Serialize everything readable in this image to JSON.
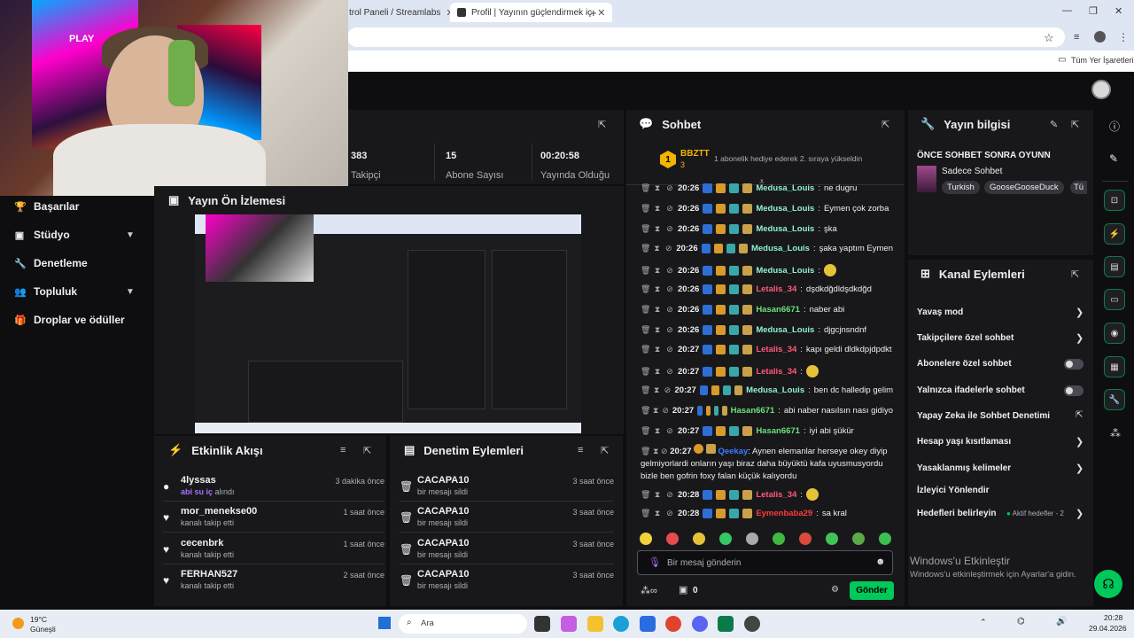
{
  "browser": {
    "tab1": "trol Paneli / Streamlabs",
    "tab2": "Profil | Yayının güçlendirmek iç",
    "bookmarks": "Tüm Yer İşaretleri",
    "new_tab": "+"
  },
  "webcam": {
    "play_text": "PLAY"
  },
  "nav": [
    {
      "label": "Başarılar",
      "icon": "trophy-icon"
    },
    {
      "label": "Stüdyo",
      "icon": "studio-icon"
    },
    {
      "label": "Denetleme",
      "icon": "wrench-icon"
    },
    {
      "label": "Topluluk",
      "icon": "community-icon"
    },
    {
      "label": "Droplar ve ödüller",
      "icon": "gift-icon"
    }
  ],
  "stats": [
    {
      "value": "383",
      "label": "Takipçi"
    },
    {
      "value": "15",
      "label": "Abone Sayısı"
    },
    {
      "value": "00:20:58",
      "label": "Yayında Olduğu"
    }
  ],
  "preview": {
    "title": "Yayın Ön İzlemesi"
  },
  "activity": {
    "title": "Etkinlik Akışı",
    "items": [
      {
        "name": "4lyssas",
        "sub_hl": "abi su iç",
        "sub": "alındı",
        "time": "3 dakika önce",
        "icon": "bits-icon"
      },
      {
        "name": "mor_menekse00",
        "sub": "kanalı takip etti",
        "time": "1 saat önce",
        "icon": "heart-icon"
      },
      {
        "name": "cecenbrk",
        "sub": "kanalı takip etti",
        "time": "1 saat önce",
        "icon": "heart-icon"
      },
      {
        "name": "FERHAN527",
        "sub": "kanalı takip etti",
        "time": "2 saat önce",
        "icon": "heart-icon"
      }
    ]
  },
  "moderation": {
    "title": "Denetim Eylemleri",
    "items": [
      {
        "name": "CACAPA10",
        "sub": "bir mesajı sildi",
        "time": "3 saat önce"
      },
      {
        "name": "CACAPA10",
        "sub": "bir mesajı sildi",
        "time": "3 saat önce"
      },
      {
        "name": "CACAPA10",
        "sub": "bir mesajı sildi",
        "time": "3 saat önce"
      },
      {
        "name": "CACAPA10",
        "sub": "bir mesajı sildi",
        "time": "3 saat önce"
      }
    ]
  },
  "chat": {
    "title": "Sohbet",
    "top_gifter": "BBZTT",
    "top_gifter_count": "3",
    "top_gifter_rank": "1",
    "gift_note": "1 abonelik hediye ederek 2. sıraya yükseldin",
    "messages": [
      {
        "time": "20:26",
        "user": "Medusa_Louis",
        "color": "#8ff0d0",
        "text": "ne dugru"
      },
      {
        "time": "20:26",
        "user": "Medusa_Louis",
        "color": "#8ff0d0",
        "text": "Eymen çok zorba"
      },
      {
        "time": "20:26",
        "user": "Medusa_Louis",
        "color": "#8ff0d0",
        "text": "şka"
      },
      {
        "time": "20:26",
        "user": "Medusa_Louis",
        "color": "#8ff0d0",
        "text": "şaka yaptım Eymen"
      },
      {
        "time": "20:26",
        "user": "Medusa_Louis",
        "color": "#8ff0d0",
        "text": ""
      },
      {
        "time": "20:26",
        "user": "Letalis_34",
        "color": "#ff5a78",
        "text": "dşdkdğdldşdkdğd"
      },
      {
        "time": "20:26",
        "user": "Hasan6671",
        "color": "#6fe07a",
        "text": "naber abi"
      },
      {
        "time": "20:26",
        "user": "Medusa_Louis",
        "color": "#8ff0d0",
        "text": "djgcjnsndnf"
      },
      {
        "time": "20:27",
        "user": "Letalis_34",
        "color": "#ff5a78",
        "text": "kapı geldi dldkdpjdpdkt"
      },
      {
        "time": "20:27",
        "user": "Letalis_34",
        "color": "#ff5a78",
        "text": ""
      },
      {
        "time": "20:27",
        "user": "Medusa_Louis",
        "color": "#8ff0d0",
        "text": "ben dc halledip gelim"
      },
      {
        "time": "20:27",
        "user": "Hasan6671",
        "color": "#6fe07a",
        "text": "abi naber nasılsın nası gidiyo"
      },
      {
        "time": "20:27",
        "user": "Hasan6671",
        "color": "#6fe07a",
        "text": "iyi abi şükür"
      }
    ],
    "long_msg": {
      "time": "20:27",
      "user": "Qeekay",
      "color": "#3a7dff",
      "text": "Aynen elemanlar herseye okey diyip gelmiyorlardi onların yaşı biraz daha büyüktü kafa uyusmusyordu bizle ben gofrin foxy falan küçük kalıyordu"
    },
    "tail": [
      {
        "time": "20:28",
        "user": "Letalis_34",
        "color": "#ff5a78",
        "text": ""
      },
      {
        "time": "20:28",
        "user": "Eymenbaba29",
        "color": "#ff3a3a",
        "text": "sa kral"
      }
    ],
    "placeholder": "Bir mesaj gönderin",
    "points": "0",
    "send": "Gönder"
  },
  "stream_info": {
    "title": "Yayın bilgisi",
    "stream_title": "ÖNCE SOHBET SONRA OYUNN",
    "category": "Sadece Sohbet",
    "tags": [
      "Turkish",
      "GooseGooseDuck",
      "Tü"
    ]
  },
  "channel_actions": {
    "title": "Kanal Eylemleri",
    "items": [
      {
        "label": "Yavaş mod",
        "kind": "arrow"
      },
      {
        "label": "Takipçilere özel sohbet",
        "kind": "arrow"
      },
      {
        "label": "Abonelere özel sohbet",
        "kind": "toggle"
      },
      {
        "label": "Yalnızca ifadelerle sohbet",
        "kind": "toggle"
      },
      {
        "label": "Yapay Zeka ile Sohbet Denetimi",
        "kind": "ext"
      },
      {
        "label": "Hesap yaşı kısıtlaması",
        "kind": "arrow"
      },
      {
        "label": "Yasaklanmış kelimeler",
        "kind": "arrow"
      },
      {
        "label": "İzleyici Yönlendir",
        "kind": "none"
      },
      {
        "label": "Hedefleri belirleyin",
        "kind": "arrow",
        "extra": "Aktif hedefler - 2"
      }
    ]
  },
  "windows": {
    "activate_title": "Windows'u Etkinleştir",
    "activate_sub": "Windows'u etkinleştirmek için Ayarlar'a gidin.",
    "weather_temp": "19°C",
    "weather_desc": "Güneşli",
    "search": "Ara",
    "time": "20:28",
    "date": "29.04.2026"
  },
  "colors": {
    "accent": "#00c85a",
    "bg": "#0e0e10",
    "panel": "#18181b",
    "purple": "#a970ff"
  }
}
